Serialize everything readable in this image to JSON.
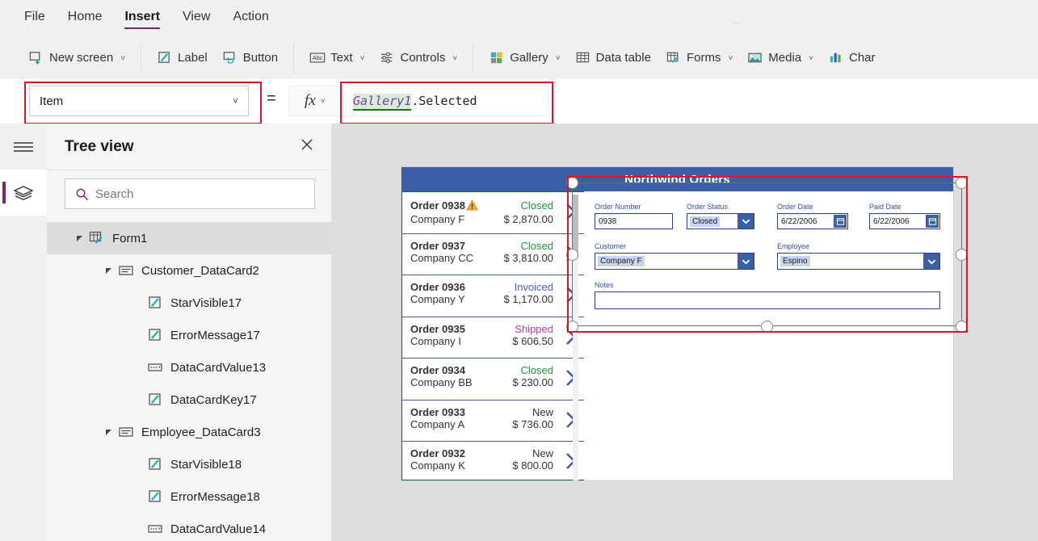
{
  "menu": {
    "items": [
      {
        "label": "File",
        "active": false
      },
      {
        "label": "Home",
        "active": false
      },
      {
        "label": "Insert",
        "active": true
      },
      {
        "label": "View",
        "active": false
      },
      {
        "label": "Action",
        "active": false
      }
    ],
    "overflow_dots": ".."
  },
  "ribbon": {
    "groups": [
      {
        "buttons": [
          {
            "label": "New screen",
            "icon": "new-screen-icon",
            "caret": true
          }
        ]
      },
      {
        "buttons": [
          {
            "label": "Label",
            "icon": "label-icon",
            "caret": false
          },
          {
            "label": "Button",
            "icon": "button-icon",
            "caret": false
          }
        ]
      },
      {
        "buttons": [
          {
            "label": "Text",
            "icon": "text-abc-icon",
            "caret": true
          },
          {
            "label": "Controls",
            "icon": "controls-sliders-icon",
            "caret": true
          }
        ]
      },
      {
        "buttons": [
          {
            "label": "Gallery",
            "icon": "gallery-icon",
            "caret": true
          },
          {
            "label": "Data table",
            "icon": "data-table-icon",
            "caret": false
          },
          {
            "label": "Forms",
            "icon": "forms-icon",
            "caret": true
          },
          {
            "label": "Media",
            "icon": "media-image-icon",
            "caret": true
          },
          {
            "label": "Char",
            "icon": "charts-icon",
            "caret": false
          }
        ]
      }
    ]
  },
  "formula_bar": {
    "property_label": "Item",
    "equals": "=",
    "fx_label": "fx",
    "expression_identifier": "Gallery1",
    "expression_rest": ".Selected"
  },
  "tree_view": {
    "title": "Tree view",
    "close_label": "×",
    "search_placeholder": "Search",
    "items": [
      {
        "label": "Form1",
        "indent": 0,
        "icon": "form-icon",
        "caret": "expanded",
        "selected": true
      },
      {
        "label": "Customer_DataCard2",
        "indent": 1,
        "icon": "datacard-icon",
        "caret": "expanded",
        "selected": false
      },
      {
        "label": "StarVisible17",
        "indent": 2,
        "icon": "label-control-icon",
        "caret": "none",
        "selected": false
      },
      {
        "label": "ErrorMessage17",
        "indent": 2,
        "icon": "label-control-icon",
        "caret": "none",
        "selected": false
      },
      {
        "label": "DataCardValue13",
        "indent": 2,
        "icon": "dropdown-control-icon",
        "caret": "none",
        "selected": false
      },
      {
        "label": "DataCardKey17",
        "indent": 2,
        "icon": "label-control-icon",
        "caret": "none",
        "selected": false
      },
      {
        "label": "Employee_DataCard3",
        "indent": 1,
        "icon": "datacard-icon",
        "caret": "expanded",
        "selected": false
      },
      {
        "label": "StarVisible18",
        "indent": 2,
        "icon": "label-control-icon",
        "caret": "none",
        "selected": false
      },
      {
        "label": "ErrorMessage18",
        "indent": 2,
        "icon": "label-control-icon",
        "caret": "none",
        "selected": false
      },
      {
        "label": "DataCardValue14",
        "indent": 2,
        "icon": "dropdown-control-icon",
        "caret": "none",
        "selected": false
      }
    ]
  },
  "canvas": {
    "app_title": "Northwind Orders",
    "gallery": {
      "items": [
        {
          "order": "Order 0938",
          "company": "Company F",
          "status": "Closed",
          "status_color": "#1a9a3c",
          "amount": "$ 2,870.00",
          "warning": true
        },
        {
          "order": "Order 0937",
          "company": "Company CC",
          "status": "Closed",
          "status_color": "#1a9a3c",
          "amount": "$ 3,810.00",
          "warning": false
        },
        {
          "order": "Order 0936",
          "company": "Company Y",
          "status": "Invoiced",
          "status_color": "#4a5fd0",
          "amount": "$ 1,170.00",
          "warning": false
        },
        {
          "order": "Order 0935",
          "company": "Company I",
          "status": "Shipped",
          "status_color": "#b03fb0",
          "amount": "$ 606.50",
          "warning": false
        },
        {
          "order": "Order 0934",
          "company": "Company BB",
          "status": "Closed",
          "status_color": "#1a9a3c",
          "amount": "$ 230.00",
          "warning": false
        },
        {
          "order": "Order 0933",
          "company": "Company A",
          "status": "New",
          "status_color": "#333333",
          "amount": "$ 736.00",
          "warning": false
        },
        {
          "order": "Order 0932",
          "company": "Company K",
          "status": "New",
          "status_color": "#333333",
          "amount": "$ 800.00",
          "warning": false
        }
      ]
    },
    "form": {
      "fields": [
        {
          "label": "Order Number",
          "value": "0938",
          "type": "text",
          "highlight": false
        },
        {
          "label": "Order Status",
          "value": "Closed",
          "type": "dropdown",
          "highlight": true
        },
        {
          "label": "Order Date",
          "value": "6/22/2006",
          "type": "date",
          "highlight": false
        },
        {
          "label": "Paid Date",
          "value": "6/22/2006",
          "type": "date",
          "highlight": false
        },
        {
          "label": "Customer",
          "value": "Company F",
          "type": "dropdown",
          "highlight": true
        },
        {
          "label": "Employee",
          "value": "Espino",
          "type": "dropdown",
          "highlight": true
        },
        {
          "label": "Notes",
          "value": "",
          "type": "text",
          "highlight": false
        }
      ]
    }
  },
  "colors": {
    "accent_purple": "#742774",
    "banner_blue": "#3a5fa8",
    "highlight_red": "#e81123",
    "gallery_green": "#1a6b33"
  }
}
